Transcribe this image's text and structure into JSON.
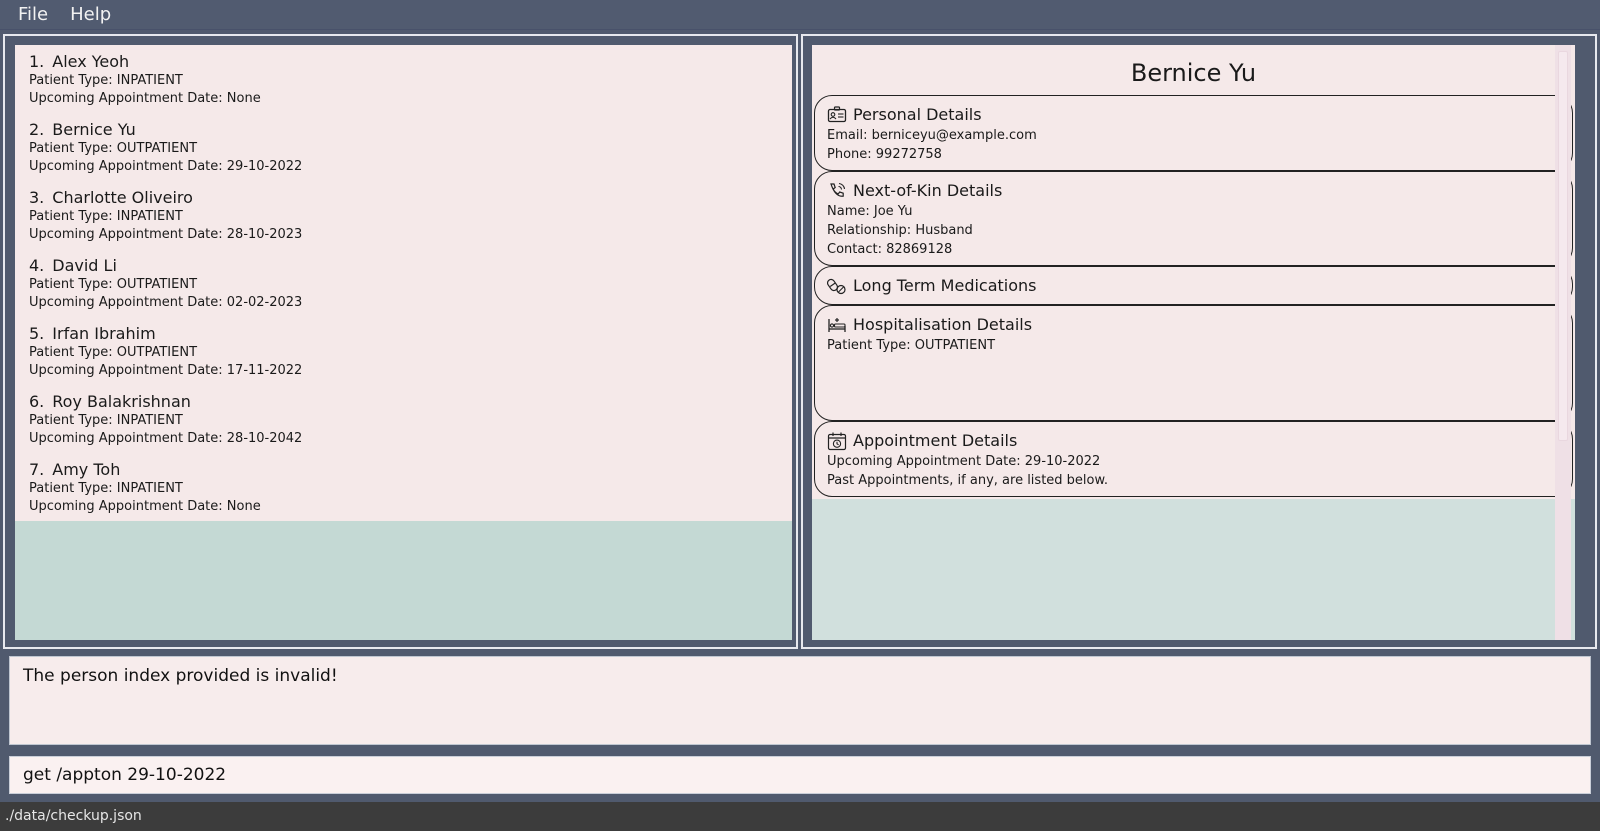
{
  "menu": {
    "file": "File",
    "help": "Help"
  },
  "patients": [
    {
      "index": "1.",
      "name": "Alex Yeoh",
      "type": "Patient Type: INPATIENT",
      "appt": "Upcoming Appointment Date: None"
    },
    {
      "index": "2.",
      "name": "Bernice Yu",
      "type": "Patient Type: OUTPATIENT",
      "appt": "Upcoming Appointment Date: 29-10-2022"
    },
    {
      "index": "3.",
      "name": "Charlotte Oliveiro",
      "type": "Patient Type: INPATIENT",
      "appt": "Upcoming Appointment Date: 28-10-2023"
    },
    {
      "index": "4.",
      "name": "David Li",
      "type": "Patient Type: OUTPATIENT",
      "appt": "Upcoming Appointment Date: 02-02-2023"
    },
    {
      "index": "5.",
      "name": "Irfan Ibrahim",
      "type": "Patient Type: OUTPATIENT",
      "appt": "Upcoming Appointment Date: 17-11-2022"
    },
    {
      "index": "6.",
      "name": "Roy Balakrishnan",
      "type": "Patient Type: INPATIENT",
      "appt": "Upcoming Appointment Date: 28-10-2042"
    },
    {
      "index": "7.",
      "name": "Amy Toh",
      "type": "Patient Type: INPATIENT",
      "appt": "Upcoming Appointment Date: None"
    }
  ],
  "detail": {
    "name": "Bernice Yu",
    "personal": {
      "title": "Personal Details",
      "email": "Email: berniceyu@example.com",
      "phone": "Phone: 99272758"
    },
    "nok": {
      "title": "Next-of-Kin Details",
      "name": "Name: Joe Yu",
      "relationship": "Relationship: Husband",
      "contact": "Contact: 82869128"
    },
    "medications": {
      "title": "Long Term Medications"
    },
    "hospitalisation": {
      "title": "Hospitalisation Details",
      "type": "Patient Type: OUTPATIENT"
    },
    "appointment": {
      "title": "Appointment Details",
      "upcoming": "Upcoming Appointment Date: 29-10-2022",
      "past": "Past Appointments, if any, are listed below."
    }
  },
  "result": {
    "message": "The person index provided is invalid!"
  },
  "command": {
    "value": "get /appton 29-10-2022"
  },
  "status": {
    "path": "./data/checkup.json"
  },
  "icons": {
    "personal": "id-card-icon",
    "nok": "phone-contact-icon",
    "medications": "pills-icon",
    "hospitalisation": "hospital-bed-icon",
    "appointment": "calendar-clock-icon"
  }
}
